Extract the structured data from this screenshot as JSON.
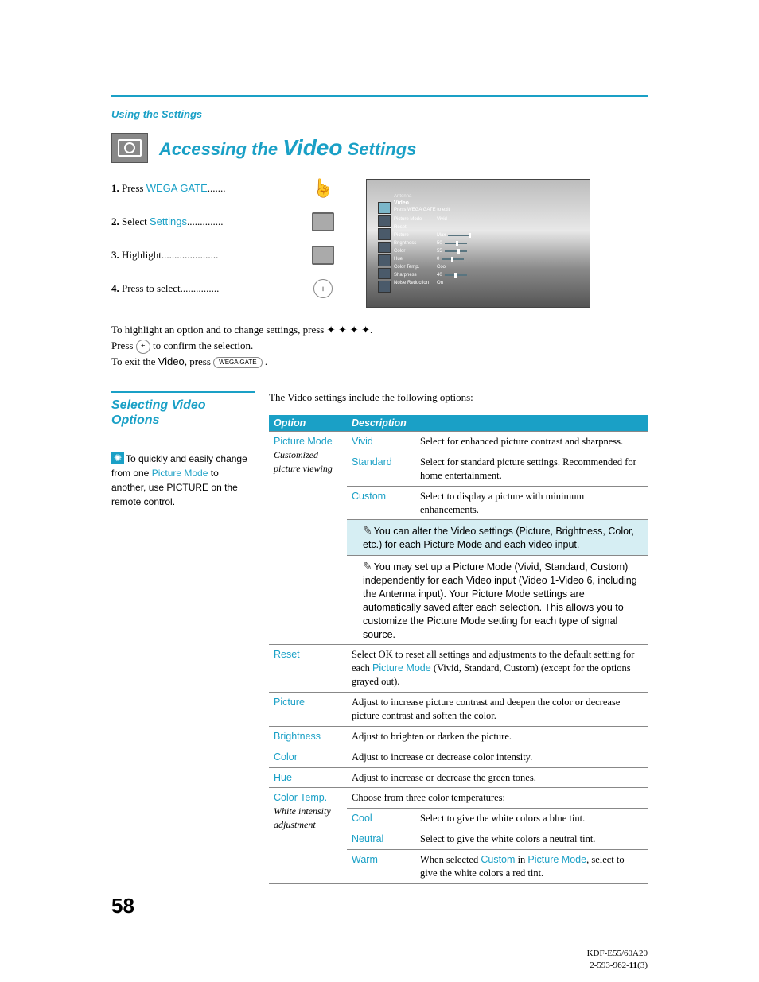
{
  "header": {
    "breadcrumb": "Using the Settings",
    "title_pre": "Accessing the ",
    "title_big": "Video",
    "title_post": " Settings"
  },
  "steps": [
    {
      "n": "1.",
      "verb": "Press ",
      "obj": "WEGA GATE",
      "dots": "......."
    },
    {
      "n": "2.",
      "verb": "Select ",
      "obj": "Settings",
      "dots": ".............."
    },
    {
      "n": "3.",
      "verb": "Highlight",
      "obj": "",
      "dots": "......................"
    },
    {
      "n": "4.",
      "verb": "Press to select",
      "obj": "",
      "dots": "..............."
    }
  ],
  "osd": {
    "top": "Antenna",
    "title": "Video",
    "subtitle": "Press WEGA GATE to exit",
    "rows": [
      {
        "k": "Picture Mode",
        "v": "Vivid",
        "slider": false
      },
      {
        "k": "Reset",
        "v": "",
        "slider": false
      },
      {
        "k": "Picture",
        "v": "Max",
        "slider": true,
        "pos": 26
      },
      {
        "k": "Brightness",
        "v": "50",
        "slider": true,
        "pos": 14
      },
      {
        "k": "Color",
        "v": "55",
        "slider": true,
        "pos": 16
      },
      {
        "k": "Hue",
        "v": "0",
        "slider": true,
        "pos": 12
      },
      {
        "k": "Color Temp.",
        "v": "Cool",
        "slider": false
      },
      {
        "k": "Sharpness",
        "v": "40",
        "slider": true,
        "pos": 12
      },
      {
        "k": "Noise Reduction",
        "v": "On",
        "slider": false
      }
    ]
  },
  "instr": {
    "line1a": "To highlight an option and to change settings, press ",
    "arrows": "✦ ✦ ✦ ✦",
    "period": ".",
    "line2a": "Press ",
    "line2b": " to confirm the selection.",
    "line3a": "To exit the ",
    "videoword": "Video",
    "line3b": ", press ",
    "line3c": "."
  },
  "side": {
    "subhead": "Selecting Video Options",
    "tip_a": "To quickly and easily change from one ",
    "tip_link": "Picture Mode",
    "tip_b": " to another, use PICTURE on the remote control."
  },
  "intro": "The Video settings include the following options:",
  "table": {
    "headers": [
      "Option",
      "Description"
    ],
    "rows": {
      "picmode": {
        "name": "Picture Mode",
        "sub": "Customized picture viewing",
        "vivid": {
          "name": "Vivid",
          "desc": "Select for enhanced picture contrast and sharpness."
        },
        "standard": {
          "name": "Standard",
          "desc": "Select for standard picture settings. Recommended for home entertainment."
        },
        "custom": {
          "name": "Custom",
          "desc": "Select to display a picture with minimum enhancements."
        },
        "note1": "You can alter the Video settings (Picture, Brightness, Color, etc.) for each Picture Mode and each video input.",
        "note2": "You may set up a Picture Mode (Vivid, Standard, Custom) independently for each Video input (Video 1-Video 6, including the Antenna input). Your Picture Mode settings are automatically saved after each selection. This allows you to customize the Picture Mode setting for each type of signal source."
      },
      "reset": {
        "name": "Reset",
        "desc_a": "Select OK to reset all settings and adjustments to the default setting for each ",
        "link": "Picture Mode",
        "desc_b": " (Vivid, Standard, Custom) (except for the options grayed out)."
      },
      "picture": {
        "name": "Picture",
        "desc": "Adjust to increase picture contrast and deepen the color or decrease picture contrast and soften the color."
      },
      "brightness": {
        "name": "Brightness",
        "desc": "Adjust to brighten or darken the picture."
      },
      "color": {
        "name": "Color",
        "desc": "Adjust to increase or decrease color intensity."
      },
      "hue": {
        "name": "Hue",
        "desc": "Adjust to increase or decrease the green tones."
      },
      "colortemp": {
        "name": "Color Temp.",
        "sub": "White intensity adjustment",
        "intro": "Choose from three color temperatures:",
        "cool": {
          "name": "Cool",
          "desc": "Select to give the white colors a blue tint."
        },
        "neutral": {
          "name": "Neutral",
          "desc": "Select to give the white colors a neutral tint."
        },
        "warm": {
          "name": "Warm",
          "desc_a": "When selected ",
          "link1": "Custom",
          "mid": " in ",
          "link2": "Picture Mode",
          "desc_b": ", select to give the white colors a red tint."
        }
      }
    }
  },
  "incircle": "+",
  "pagenum": "58",
  "footer": {
    "l1": "KDF-E55/60A20",
    "l2a": "2-593-962-",
    "l2b": "11",
    "l2c": "(3)"
  }
}
